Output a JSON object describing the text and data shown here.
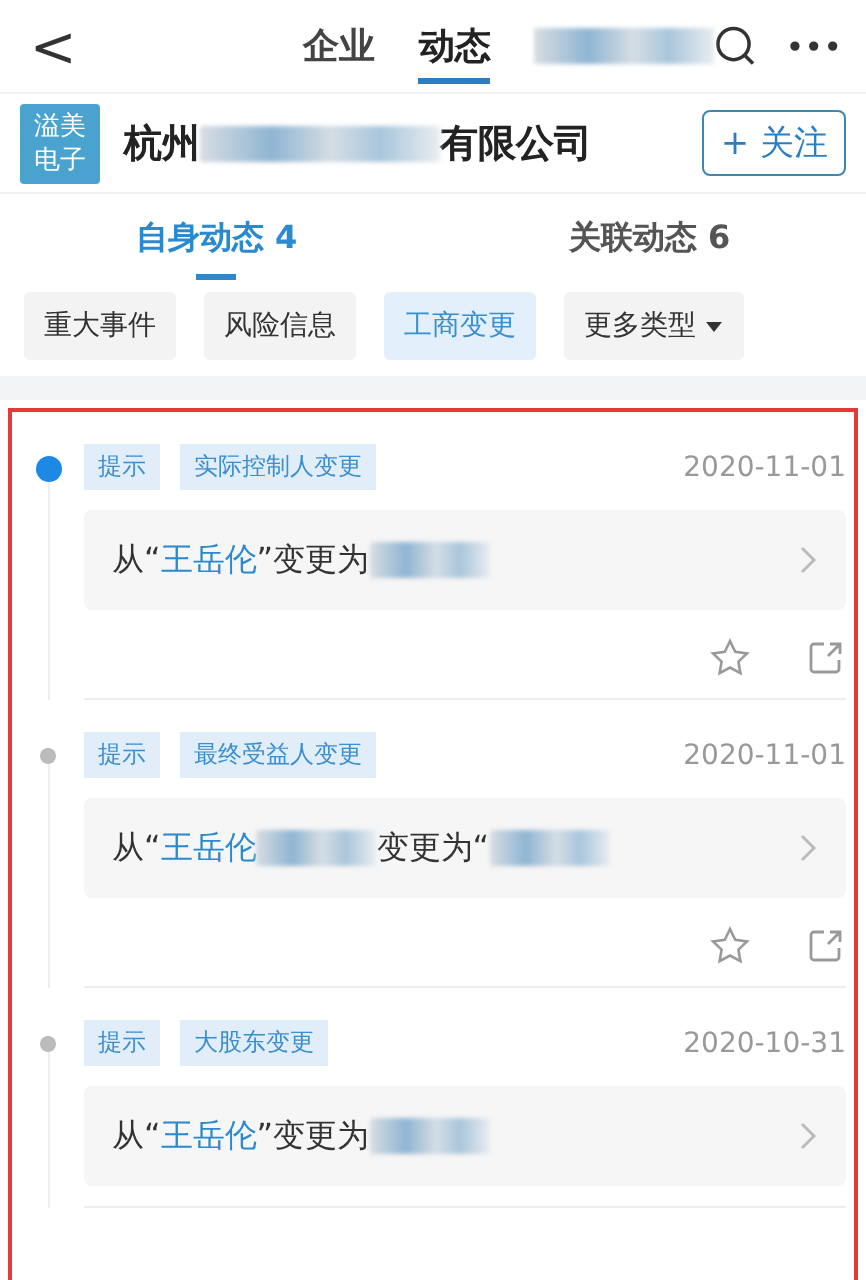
{
  "top_bar": {
    "back": "<",
    "tabs": [
      {
        "label": "企业",
        "selected": false
      },
      {
        "label": "动态",
        "selected": true
      }
    ],
    "more": "•••"
  },
  "company": {
    "logo": "溢美电子",
    "name_start": "杭州",
    "name_end": "有限公司",
    "follow": "+ 关注"
  },
  "sub_tabs": [
    {
      "label": "自身动态 4",
      "selected": true
    },
    {
      "label": "关联动态 6",
      "selected": false
    }
  ],
  "filters": [
    {
      "label": "重大事件",
      "selected": false,
      "dropdown": false
    },
    {
      "label": "风险信息",
      "selected": false,
      "dropdown": false
    },
    {
      "label": "工商变更",
      "selected": true,
      "dropdown": false
    },
    {
      "label": "更多类型",
      "selected": false,
      "dropdown": true
    }
  ],
  "events": [
    {
      "latest": true,
      "tags": [
        "提示",
        "实际控制人变更"
      ],
      "date": "2020-11-01",
      "segments": [
        {
          "kind": "plain",
          "text": "从“"
        },
        {
          "kind": "link",
          "text": "王岳伦"
        },
        {
          "kind": "plain",
          "text": "”变更为"
        },
        {
          "kind": "blur"
        }
      ],
      "actions": true
    },
    {
      "latest": false,
      "tags": [
        "提示",
        "最终受益人变更"
      ],
      "date": "2020-11-01",
      "segments": [
        {
          "kind": "plain",
          "text": "从“"
        },
        {
          "kind": "link",
          "text": "王岳伦"
        },
        {
          "kind": "blur"
        },
        {
          "kind": "plain",
          "text": "变更为“"
        },
        {
          "kind": "blur"
        }
      ],
      "actions": true
    },
    {
      "latest": false,
      "tags": [
        "提示",
        "大股东变更"
      ],
      "date": "2020-10-31",
      "segments": [
        {
          "kind": "plain",
          "text": "从“"
        },
        {
          "kind": "link",
          "text": "王岳伦"
        },
        {
          "kind": "plain",
          "text": "”变更为"
        },
        {
          "kind": "blur"
        }
      ],
      "actions": false
    }
  ]
}
